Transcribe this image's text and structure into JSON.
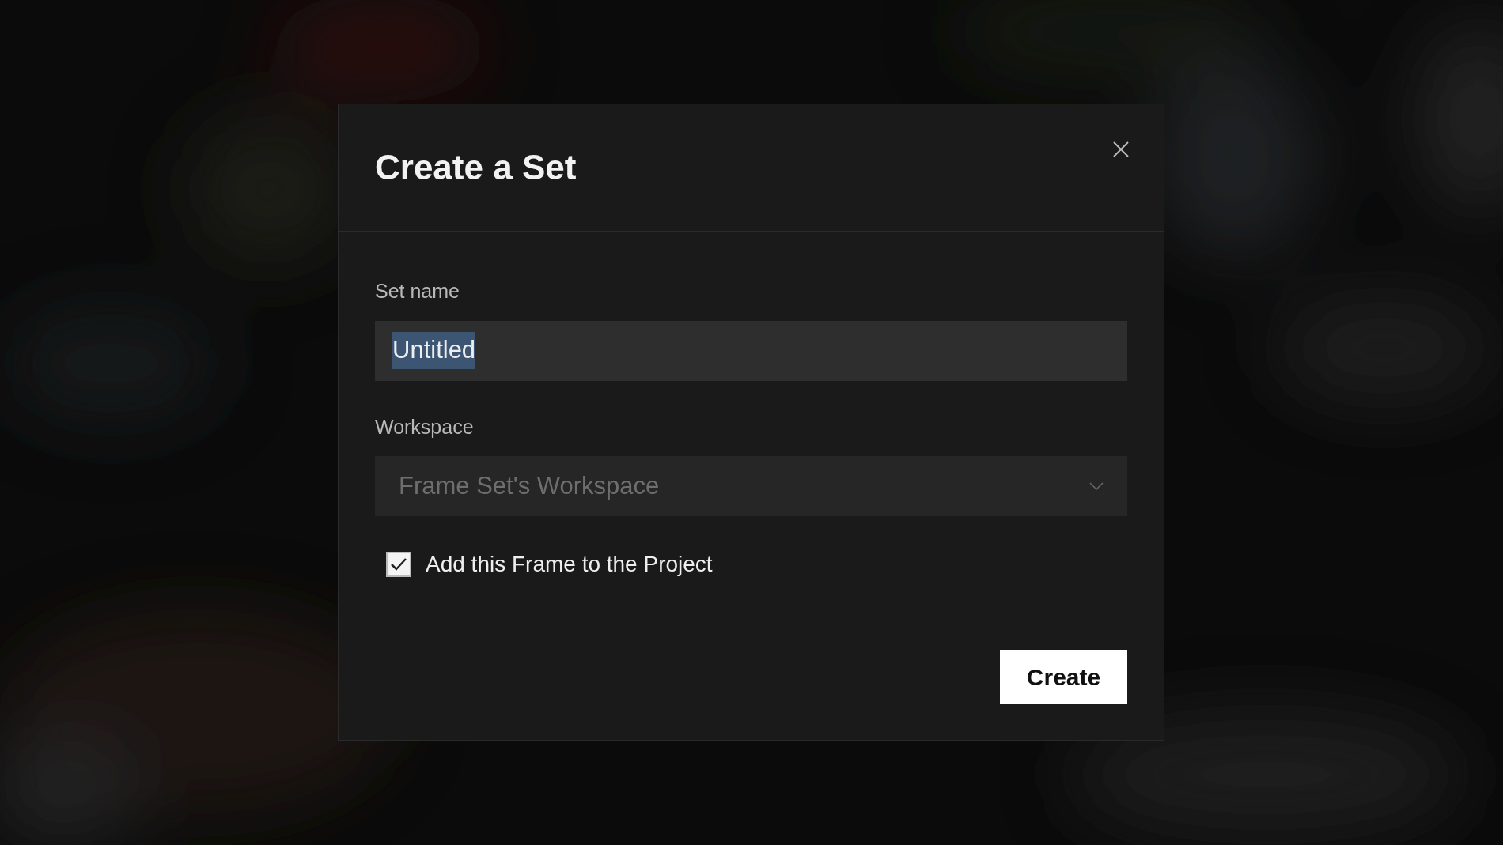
{
  "dialog": {
    "title": "Create a Set",
    "fields": [
      {
        "kind": "text",
        "label": "Set name",
        "value": "Untitled",
        "text_selected": true
      },
      {
        "kind": "select",
        "label": "Workspace",
        "value": "Frame Set's Workspace",
        "disabled": true
      }
    ],
    "checkbox": {
      "label": "Add this Frame to the Project",
      "checked": true
    },
    "buttons": [
      {
        "label": "Create"
      }
    ]
  }
}
